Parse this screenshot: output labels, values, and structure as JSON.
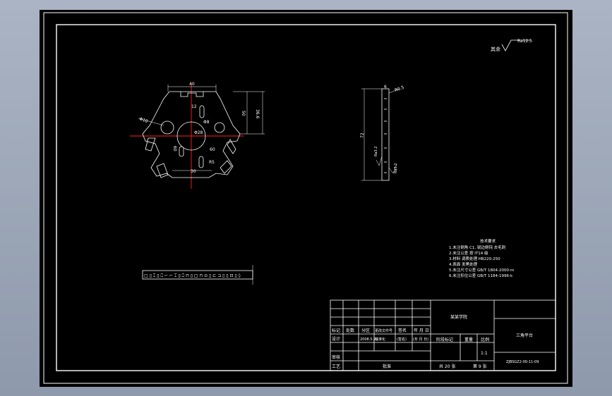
{
  "colors": {
    "background": "#000000",
    "frame": "#ffffff",
    "center_line": "#ff2020",
    "viewport_outer": "#97a2b4"
  },
  "drawing": {
    "roughness_prefix": "其余",
    "roughness_value": "Ra12.5",
    "part_dims": {
      "width_top": "40",
      "height": "50",
      "height_total": "36.6",
      "slot_small": "12",
      "bore": "Φ28",
      "hole_a": "Φ10",
      "hole_b": "Φ8",
      "angle_a": "60",
      "angle_b": "60",
      "bottom": "30",
      "radius": "R5"
    },
    "side_dims": {
      "length": "72",
      "thickness": "6",
      "chamfer_top": "R0.5",
      "roughness_a": "Ra3.2",
      "roughness_b": "Ra3.2"
    },
    "strip_text": "□ ▯ ⌶ ▯ ⎕ ⌐ ⌐ ⌶ ▯ ⎕ ⊓ ▯ □ ⊓ ⊙ ▯ ⊏ ⊐ ▯ ▯ ⊡ ▯ ◊",
    "notes": {
      "title": "技术要求",
      "items": [
        "1.未注倒角 C1,  锐边倒钝 去毛刺",
        "2.未注公差 按 IT14 级",
        "3.材料 调质处理 HB220-250",
        "4.表面 发黑处理",
        "5.未注尺寸公差 GB/T 1804-2000-m",
        "6.未注形位公差 GB/T 1184-1996-k"
      ]
    }
  },
  "title_block": {
    "school": "某某学院",
    "part_name": "三角平台",
    "drawing_no": "ZJBSGZ2-00-11-09",
    "headers": [
      "标记",
      "处数",
      "分区",
      "更改文件号",
      "签名",
      "年 月 日"
    ],
    "design_label": "设计",
    "design_date": "2008.5.23",
    "standard_label": "标准化",
    "sign_label": "(签名)",
    "date_label": "(年 月 日)",
    "stage_label": "阶段标记",
    "weight_label": "重量",
    "scale_label": "比例",
    "scale_value": "1:1",
    "check_label": "审核",
    "process_label": "工艺",
    "approve_label": "批准",
    "sheets_total": "共 20 张",
    "sheet_no": "第 9 张"
  }
}
